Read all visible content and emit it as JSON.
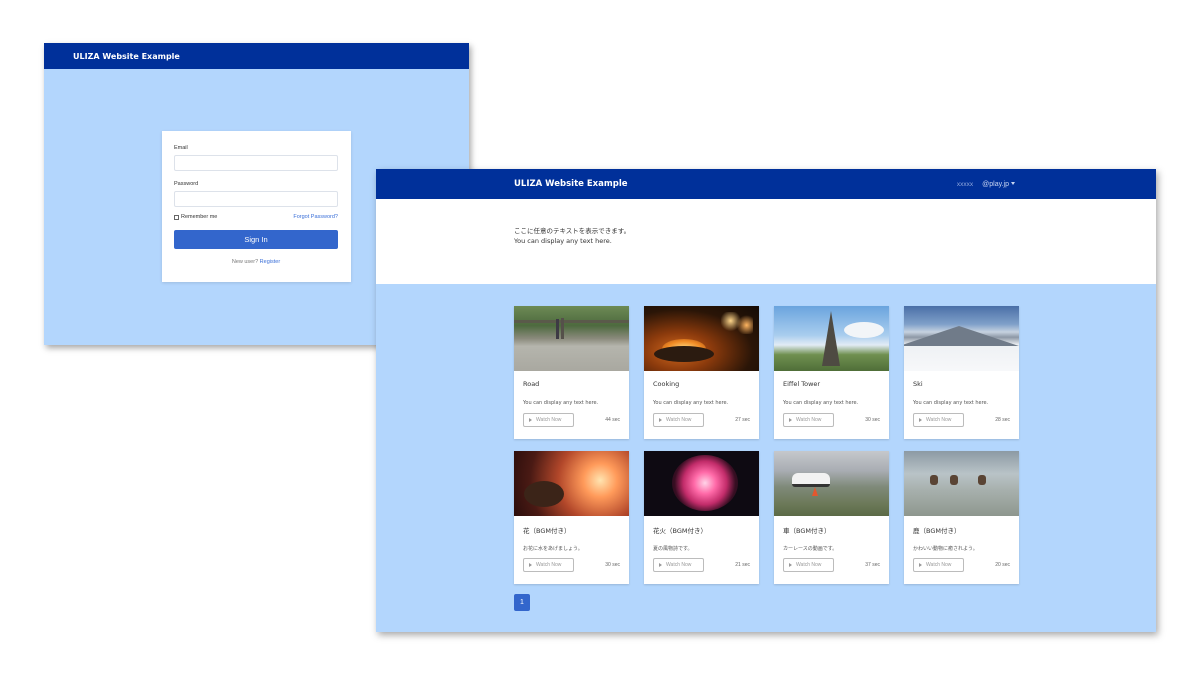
{
  "login_window": {
    "brand": "ULIZA Website Example",
    "email_label": "Email",
    "email_value": "",
    "password_label": "Password",
    "password_value": "",
    "remember_label": "Remember me",
    "forgot_label": "Forgot Password?",
    "signin_label": "Sign In",
    "new_user_text": "New user?",
    "register_label": "Register"
  },
  "main_window": {
    "brand": "ULIZA Website Example",
    "nav_user": "xxxxx",
    "nav_domain": "@play.jp",
    "hero_line1": "ここに任意のテキストを表示できます。",
    "hero_line2": "You can display any text here.",
    "watch_label": "Watch Now",
    "videos": [
      {
        "title": "Road",
        "description": "You can display any text here.",
        "duration": "44 sec",
        "thumb": "road"
      },
      {
        "title": "Cooking",
        "description": "You can display any text here.",
        "duration": "27 sec",
        "thumb": "cooking"
      },
      {
        "title": "Eiffel Tower",
        "description": "You can display any text here.",
        "duration": "30 sec",
        "thumb": "eiffel"
      },
      {
        "title": "Ski",
        "description": "You can display any text here.",
        "duration": "28 sec",
        "thumb": "ski"
      },
      {
        "title": "花（BGM付き）",
        "description": "お花に水をあげましょう。",
        "duration": "30 sec",
        "thumb": "flower"
      },
      {
        "title": "花火（BGM付き）",
        "description": "夏の風物詩です。",
        "duration": "21 sec",
        "thumb": "fireworks"
      },
      {
        "title": "車（BGM付き）",
        "description": "カーレースの動画です。",
        "duration": "37 sec",
        "thumb": "car"
      },
      {
        "title": "鹿（BGM付き）",
        "description": "かわいい動物に癒されよう。",
        "duration": "20 sec",
        "thumb": "deer"
      }
    ],
    "pagination_current": "1"
  },
  "colors": {
    "navbar": "#00309a",
    "background": "#b3d6fd",
    "accent": "#3366cc"
  }
}
